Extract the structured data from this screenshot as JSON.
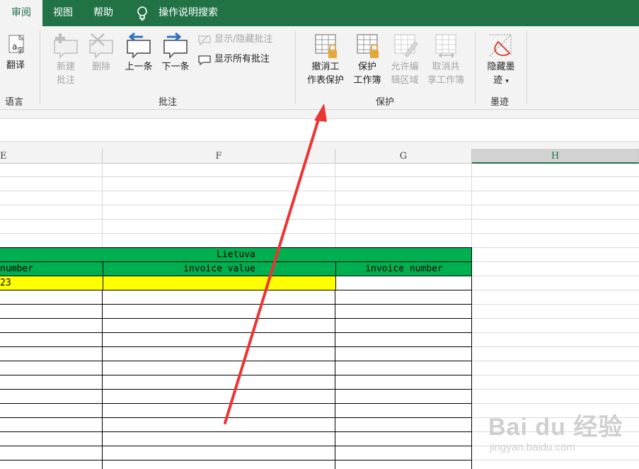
{
  "tabs": {
    "review": "审阅",
    "view": "视图",
    "help": "帮助",
    "tell_me": "操作说明搜索"
  },
  "ribbon": {
    "language": {
      "translate_label": "翻译",
      "group_label": "语言"
    },
    "comments": {
      "new_line1": "新建",
      "new_line2": "批注",
      "delete": "删除",
      "previous": "上一条",
      "next": "下一条",
      "show_hide": "显示/隐藏批注",
      "show_all": "显示所有批注",
      "group_label": "批注"
    },
    "protect": {
      "unprotect_sheet_line1": "撤消工",
      "unprotect_sheet_line2": "作表保护",
      "protect_workbook_line1": "保护",
      "protect_workbook_line2": "工作簿",
      "allow_edit_line1": "允许编",
      "allow_edit_line2": "辑区域",
      "unshare_line1": "取消共",
      "unshare_line2": "享工作簿",
      "group_label": "保护"
    },
    "ink": {
      "hide_ink_line1": "隐藏墨",
      "hide_ink_line2": "迹",
      "group_label": "墨迹"
    }
  },
  "columns": [
    "E",
    "F",
    "G",
    "H"
  ],
  "sheet": {
    "merged_header": "Lietuva",
    "headers": [
      "number",
      "invoice value",
      "invoice number"
    ],
    "first_row_value": "23"
  },
  "watermark": {
    "main": "Bai du 经验",
    "sub": "jingyan.baidu.com"
  },
  "colors": {
    "excel_green": "#217346",
    "table_green": "#00b050",
    "highlight_yellow": "#ffff00",
    "arrow_red": "#ee3333"
  }
}
